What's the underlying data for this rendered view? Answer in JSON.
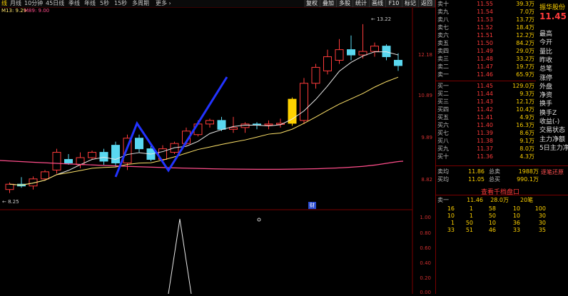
{
  "toolbar": {
    "periods": [
      "线",
      "月线",
      "10分钟",
      "45日线",
      "季线",
      "年线",
      "5秒",
      "15秒",
      "多周期",
      "更多 ›"
    ],
    "selected_index": 0,
    "buttons": [
      "复权",
      "叠加",
      "多股",
      "统计",
      "画线",
      "F10",
      "标记",
      "返回"
    ]
  },
  "ma_legend": [
    {
      "text": "M13: 9.29",
      "color": "#ffe36a"
    },
    {
      "text": "M89: 9.00",
      "color": "#ff4d8a"
    }
  ],
  "chart": {
    "type": "candlestick",
    "price_axis_labels": [
      "12.18",
      "10.89",
      "9.89",
      "8.82"
    ],
    "high_label": "13.22",
    "low_label": "8.25",
    "event_marker": "财",
    "sub_axis_labels": [
      "1.00",
      "0.80",
      "0.60",
      "0.40",
      "0.20",
      "0.00"
    ],
    "candles": [
      {
        "o": 8.55,
        "h": 8.75,
        "l": 8.45,
        "c": 8.7
      },
      {
        "o": 8.7,
        "h": 8.9,
        "l": 8.6,
        "c": 8.65
      },
      {
        "o": 8.65,
        "h": 8.92,
        "l": 8.55,
        "c": 8.85
      },
      {
        "o": 8.85,
        "h": 9.1,
        "l": 8.8,
        "c": 9.05
      },
      {
        "o": 9.1,
        "h": 9.7,
        "l": 9.0,
        "c": 9.6
      },
      {
        "o": 9.4,
        "h": 9.55,
        "l": 9.25,
        "c": 9.3
      },
      {
        "o": 9.25,
        "h": 9.6,
        "l": 9.15,
        "c": 9.45
      },
      {
        "o": 9.45,
        "h": 9.65,
        "l": 9.4,
        "c": 9.6
      },
      {
        "o": 9.6,
        "h": 9.7,
        "l": 9.25,
        "c": 9.35
      },
      {
        "o": 9.8,
        "h": 9.9,
        "l": 9.2,
        "c": 9.3
      },
      {
        "o": 9.3,
        "h": 10.1,
        "l": 9.1,
        "c": 10.0
      },
      {
        "o": 10.0,
        "h": 10.1,
        "l": 9.6,
        "c": 9.7
      },
      {
        "o": 9.7,
        "h": 9.85,
        "l": 9.35,
        "c": 9.4
      },
      {
        "o": 9.4,
        "h": 9.8,
        "l": 9.3,
        "c": 9.7
      },
      {
        "o": 9.6,
        "h": 9.9,
        "l": 9.55,
        "c": 9.85
      },
      {
        "o": 9.85,
        "h": 10.3,
        "l": 9.8,
        "c": 10.2
      },
      {
        "o": 10.1,
        "h": 10.5,
        "l": 10.05,
        "c": 10.4
      },
      {
        "o": 10.4,
        "h": 10.55,
        "l": 10.3,
        "c": 10.5
      },
      {
        "o": 10.5,
        "h": 10.6,
        "l": 10.2,
        "c": 10.25
      },
      {
        "o": 10.25,
        "h": 10.6,
        "l": 10.15,
        "c": 10.3
      },
      {
        "o": 10.3,
        "h": 10.45,
        "l": 10.15,
        "c": 10.4
      },
      {
        "o": 10.4,
        "h": 10.45,
        "l": 10.25,
        "c": 10.38
      },
      {
        "o": 10.38,
        "h": 10.5,
        "l": 10.25,
        "c": 10.4
      },
      {
        "o": 10.4,
        "h": 10.55,
        "l": 10.3,
        "c": 10.42
      },
      {
        "o": 10.42,
        "h": 11.15,
        "l": 10.35,
        "c": 11.1
      },
      {
        "o": 10.5,
        "h": 11.7,
        "l": 10.4,
        "c": 11.55
      },
      {
        "o": 11.55,
        "h": 12.1,
        "l": 11.4,
        "c": 12.0
      },
      {
        "o": 11.9,
        "h": 12.5,
        "l": 11.8,
        "c": 12.3
      },
      {
        "o": 12.2,
        "h": 12.8,
        "l": 12.1,
        "c": 12.5
      },
      {
        "o": 12.5,
        "h": 12.9,
        "l": 12.2,
        "c": 12.35
      },
      {
        "o": 12.35,
        "h": 13.22,
        "l": 12.25,
        "c": 12.45
      },
      {
        "o": 12.45,
        "h": 12.7,
        "l": 12.3,
        "c": 12.6
      },
      {
        "o": 12.6,
        "h": 12.65,
        "l": 12.2,
        "c": 12.3
      },
      {
        "o": 12.2,
        "h": 12.4,
        "l": 11.9,
        "c": 12.05
      }
    ],
    "colors": {
      "up": "#ff3b3b",
      "down": "#5ad8f0",
      "doji": "#ffd200",
      "ma_a": "#e8e8e8",
      "ma_b": "#ffe36a",
      "ma_c": "#ff4d8a",
      "drawn_line": "#2233ff",
      "grid": "#7a0000",
      "sub_line": "#e8e8e8"
    }
  },
  "right_panel": {
    "stock_name": "振华股份",
    "stock_price": "11.45",
    "orderbook_sell": [
      {
        "label": "卖十",
        "price": "11.55",
        "vol": "39.3万",
        "price_color": "red"
      },
      {
        "label": "卖九",
        "price": "11.54",
        "vol": "7.0万",
        "price_color": "red"
      },
      {
        "label": "卖八",
        "price": "11.53",
        "vol": "13.7万",
        "price_color": "red"
      },
      {
        "label": "卖七",
        "price": "11.52",
        "vol": "18.4万",
        "price_color": "red"
      },
      {
        "label": "卖六",
        "price": "11.51",
        "vol": "12.2万",
        "price_color": "red"
      },
      {
        "label": "卖五",
        "price": "11.50",
        "vol": "84.2万",
        "price_color": "red"
      },
      {
        "label": "卖四",
        "price": "11.49",
        "vol": "29.0万",
        "price_color": "red"
      },
      {
        "label": "卖三",
        "price": "11.48",
        "vol": "33.2万",
        "price_color": "red"
      },
      {
        "label": "卖二",
        "price": "11.47",
        "vol": "19.7万",
        "price_color": "red"
      },
      {
        "label": "卖一",
        "price": "11.46",
        "vol": "65.9万",
        "price_color": "red"
      }
    ],
    "orderbook_buy": [
      {
        "label": "买一",
        "price": "11.45",
        "vol": "129.0万",
        "price_color": "red"
      },
      {
        "label": "买二",
        "price": "11.44",
        "vol": "9.3万",
        "price_color": "red"
      },
      {
        "label": "买三",
        "price": "11.43",
        "vol": "12.1万",
        "price_color": "red"
      },
      {
        "label": "买四",
        "price": "11.42",
        "vol": "10.4万",
        "price_color": "red"
      },
      {
        "label": "买五",
        "price": "11.41",
        "vol": "4.9万",
        "price_color": "red"
      },
      {
        "label": "买六",
        "price": "11.40",
        "vol": "16.3万",
        "price_color": "red"
      },
      {
        "label": "买七",
        "price": "11.39",
        "vol": "8.6万",
        "price_color": "red"
      },
      {
        "label": "买八",
        "price": "11.38",
        "vol": "9.1万",
        "price_color": "red"
      },
      {
        "label": "买九",
        "price": "11.37",
        "vol": "8.0万",
        "price_color": "red"
      },
      {
        "label": "买十",
        "price": "11.36",
        "vol": "4.3万",
        "price_color": "red"
      }
    ],
    "info_labels": [
      "最高",
      "今开",
      "量比",
      "昨收",
      "总笔",
      "涨停",
      "外盘",
      "净资",
      "换手",
      "换手Z",
      "收益(-)",
      "交易状态",
      "主力净额",
      "5日主力净"
    ],
    "summary": [
      {
        "label": "卖均",
        "price": "11.86",
        "tag": "总卖",
        "vol": "1988万"
      },
      {
        "label": "买均",
        "price": "11.05",
        "tag": "总买",
        "vol": "990.1万"
      }
    ],
    "link_text": "查看千档盘口",
    "side_tag": "逐笔还原",
    "tick_header": {
      "label": "卖一",
      "price": "11.46",
      "vol": "28.0万",
      "count": "20笔"
    },
    "tick_rows": [
      [
        "16",
        "1",
        "58",
        "10",
        "100"
      ],
      [
        "10",
        "1",
        "50",
        "10",
        "30"
      ],
      [
        "1",
        "50",
        "10",
        "36",
        "30"
      ],
      [
        "33",
        "51",
        "46",
        "33",
        "35"
      ]
    ]
  }
}
